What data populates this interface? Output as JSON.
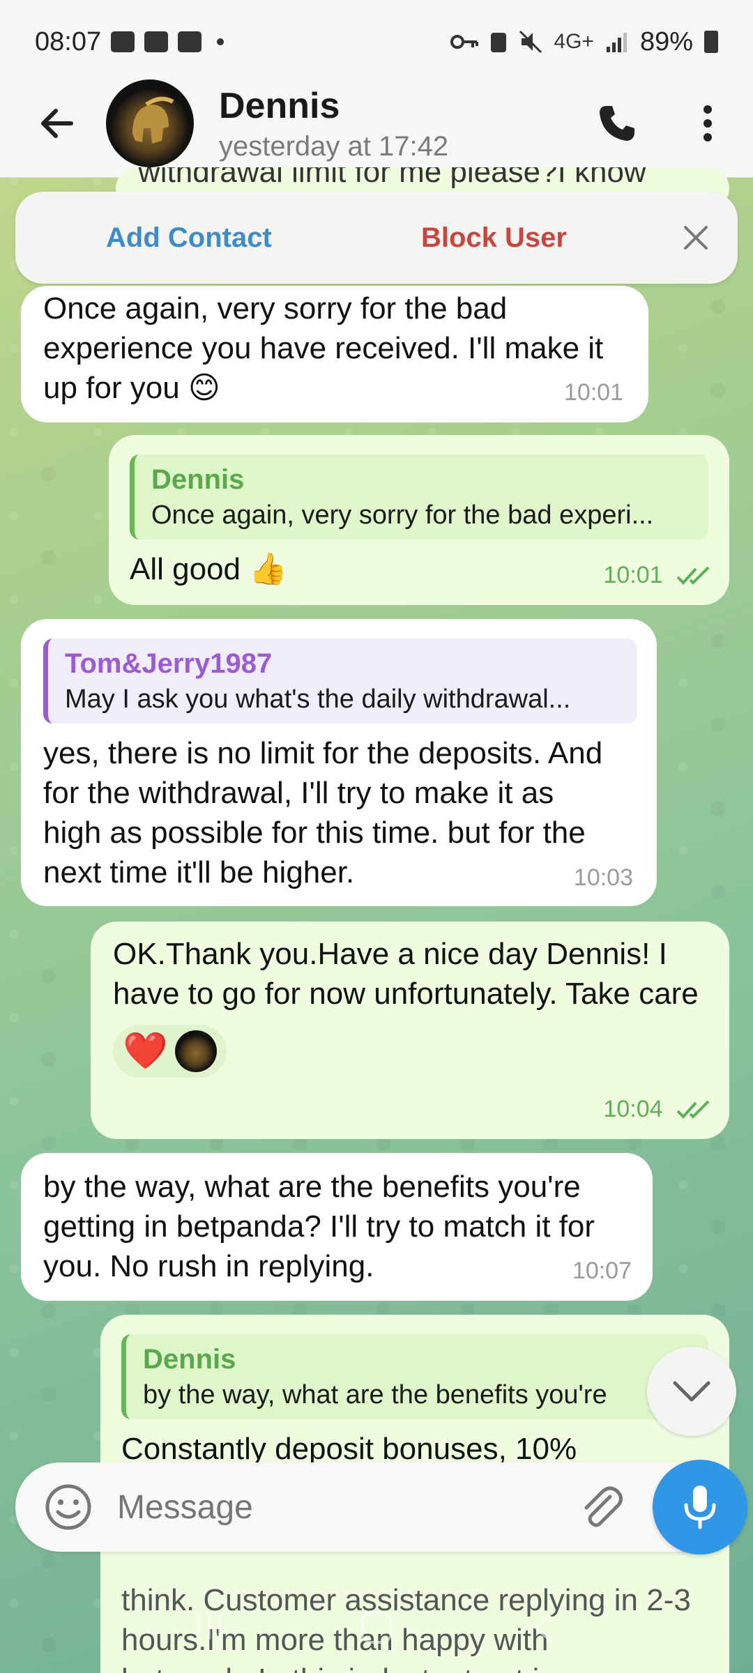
{
  "status_bar": {
    "time": "08:07",
    "network": "4G+",
    "battery": "89%"
  },
  "header": {
    "name": "Dennis",
    "last_seen": "yesterday at 17:42"
  },
  "behind_text": "withdrawal limit for me please?I know",
  "action_bar": {
    "add_contact": "Add Contact",
    "block_user": "Block User"
  },
  "messages": [
    {
      "side": "in",
      "text": "Once again, very sorry for the bad experience you have received. I'll make it up for you 😊",
      "time": "10:01"
    },
    {
      "side": "out",
      "reply_name": "Dennis",
      "reply_text": "Once again, very sorry for the bad experi...",
      "text": "All good 👍",
      "time": "10:01"
    },
    {
      "side": "in",
      "reply_name": "Tom&Jerry1987",
      "reply_text": "May I ask you what's the daily withdrawal...",
      "text": "yes, there is no limit for the deposits. And for the withdrawal, I'll try to make it as high as possible for this time. but for the next time it'll be higher.",
      "time": "10:03"
    },
    {
      "side": "out",
      "text": "OK.Thank you.Have a nice day Dennis! I have to go for now unfortunately. Take care",
      "reaction": "❤️",
      "time": "10:04"
    },
    {
      "side": "in",
      "text": "by the way, what are the benefits you're getting in betpanda? I'll try to match it for you. No rush in replying.",
      "time": "10:07"
    },
    {
      "side": "out",
      "reply_name": "Dennis",
      "reply_text": "by the way, what are the benefits you're",
      "text_top": "Constantly deposit bonuses, 10%",
      "text_bottom": "think. Customer assistance replying in 2-3 hours.I'm more than happy with betpanda.In this industry trust is very"
    }
  ],
  "input": {
    "placeholder": "Message"
  },
  "icons": {
    "back": "arrow-left-icon",
    "call": "phone-icon",
    "menu": "more-vertical-icon",
    "close": "close-icon",
    "emoji": "smiley-icon",
    "attach": "paperclip-icon",
    "mic": "microphone-icon",
    "scroll": "chevron-down-icon"
  },
  "colors": {
    "accent": "#2f97e6",
    "add_contact": "#3d8bc8",
    "block_user": "#c9463e",
    "outgoing_bubble": "#effcdf",
    "incoming_bubble": "#ffffff"
  }
}
